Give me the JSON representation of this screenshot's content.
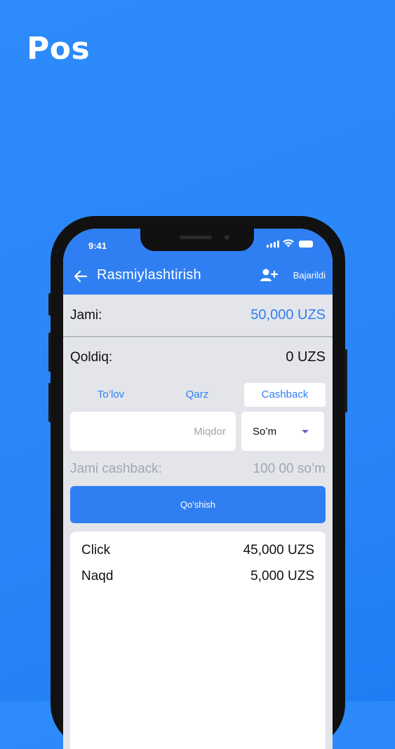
{
  "brand": "Pos",
  "status_bar": {
    "time": "9:41"
  },
  "header": {
    "title": "Rasmiylashtirish",
    "done_label": "Bajarildi"
  },
  "summary": {
    "total_label": "Jami:",
    "total_value": "50,000 UZS",
    "remaining_label": "Qoldiq:",
    "remaining_value": "0 UZS"
  },
  "tabs": [
    {
      "label": "To’lov",
      "selected": false
    },
    {
      "label": "Qarz",
      "selected": false
    },
    {
      "label": "Cashback",
      "selected": true
    }
  ],
  "amount_input": {
    "placeholder": "Miqdor",
    "value": ""
  },
  "currency_select": {
    "selected": "So’m"
  },
  "cashback": {
    "label": "Jami cashback:",
    "value": "100 00 so’m"
  },
  "add_button_label": "Qo'shish",
  "payments": [
    {
      "name": "Click",
      "amount": "45,000 UZS"
    },
    {
      "name": "Naqd",
      "amount": "5,000 UZS"
    }
  ],
  "colors": {
    "accent": "#2f7ff2",
    "background": "#2a86f8"
  }
}
